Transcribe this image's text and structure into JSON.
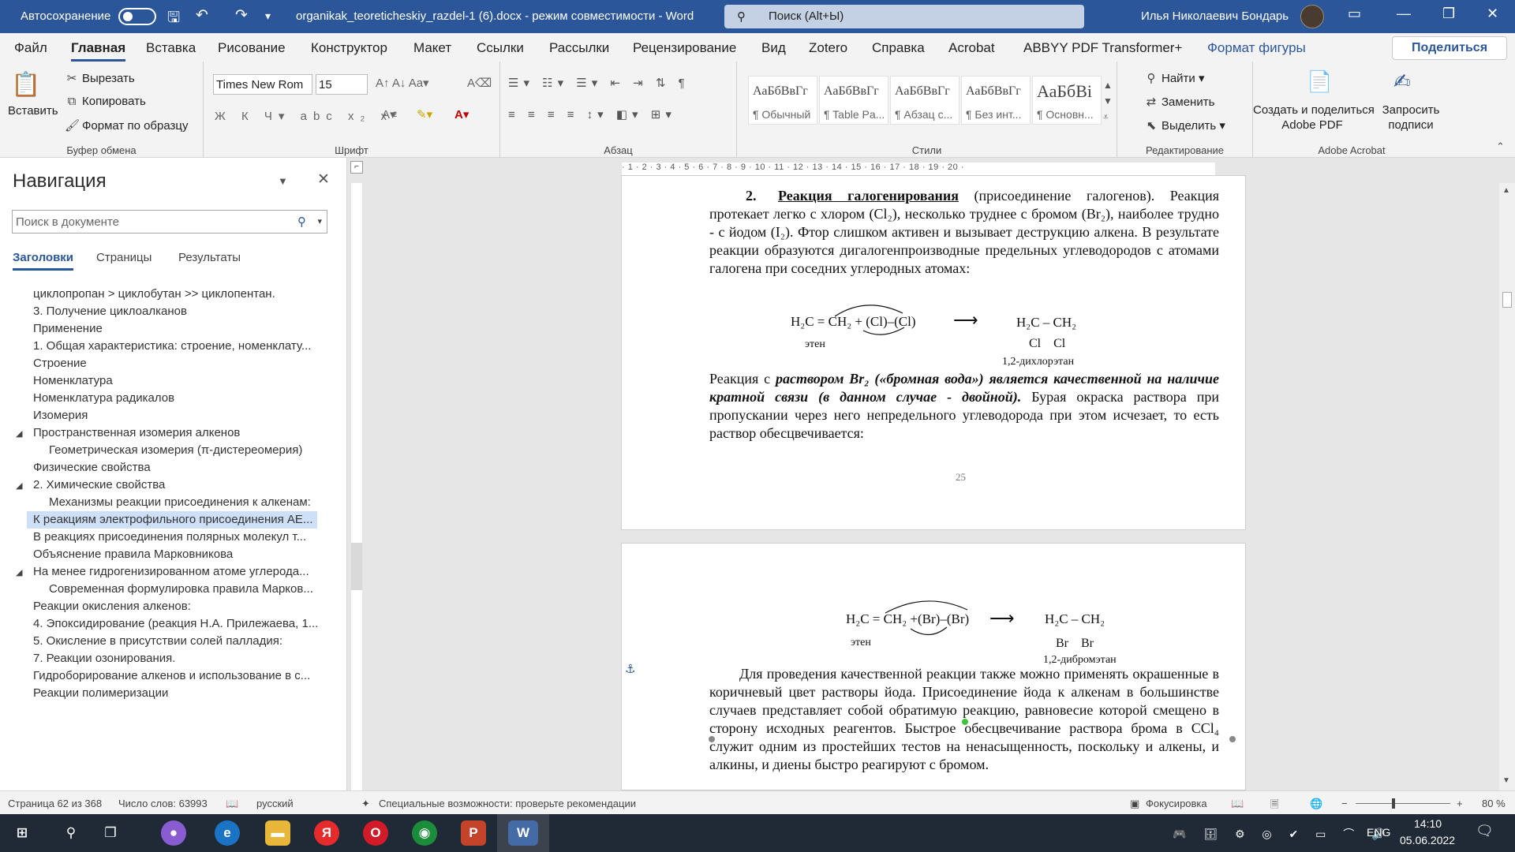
{
  "titlebar": {
    "autosave_label": "Автосохранение",
    "doc_title": "organikak_teoreticheskiy_razdel-1 (6).docx  -  режим совместимости  -  Word",
    "search_placeholder": "Поиск (Alt+Ы)",
    "user_name": "Илья Николаевич Бондарь"
  },
  "tabs": [
    "Файл",
    "Главная",
    "Вставка",
    "Рисование",
    "Конструктор",
    "Макет",
    "Ссылки",
    "Рассылки",
    "Рецензирование",
    "Вид",
    "Zotero",
    "Справка",
    "Acrobat",
    "ABBYY PDF Transformer+",
    "Формат фигуры"
  ],
  "share_label": "Поделиться",
  "ribbon": {
    "clipboard": {
      "paste": "Вставить",
      "cut": "Вырезать",
      "copy": "Копировать",
      "format_painter": "Формат по образцу",
      "label": "Буфер обмена"
    },
    "font": {
      "family": "Times New Rom",
      "size": "15",
      "label": "Шрифт"
    },
    "paragraph": {
      "label": "Абзац"
    },
    "styles": {
      "label": "Стили",
      "items": [
        {
          "sample": "АаБбВвГг",
          "name": "¶ Обычный"
        },
        {
          "sample": "АаБбВвГг",
          "name": "¶ Table Pa..."
        },
        {
          "sample": "АаБбВвГг",
          "name": "¶ Абзац с..."
        },
        {
          "sample": "АаБбВвГг",
          "name": "¶ Без инт..."
        },
        {
          "sample": "АаБбВі",
          "name": "¶ Основн..."
        }
      ]
    },
    "editing": {
      "find": "Найти",
      "replace": "Заменить",
      "select": "Выделить",
      "label": "Редактирование"
    },
    "acrobat": {
      "create": "Создать и поделиться",
      "create2": "Adobe PDF",
      "request": "Запросить",
      "request2": "подписи",
      "label": "Adobe Acrobat"
    }
  },
  "nav": {
    "title": "Навигация",
    "search_placeholder": "Поиск в документе",
    "tabs": [
      "Заголовки",
      "Страницы",
      "Результаты"
    ],
    "headings": [
      {
        "text": "циклопропан > циклобутан >> циклопентан.",
        "level": 1
      },
      {
        "text": "3. Получение циклоалканов",
        "level": 1
      },
      {
        "text": "Применение",
        "level": 1
      },
      {
        "text": "1.  Общая характеристика: строение, номенклату...",
        "level": 1
      },
      {
        "text": "Строение",
        "level": 1
      },
      {
        "text": "Номенклатура",
        "level": 1
      },
      {
        "text": "Номенклатура радикалов",
        "level": 1
      },
      {
        "text": "Изомерия",
        "level": 1
      },
      {
        "text": "Пространственная изомерия алкенов",
        "level": 1,
        "expanded": true
      },
      {
        "text": "Геометрическая изомерия (π-дистереомерия)",
        "level": 2
      },
      {
        "text": "Физические свойства",
        "level": 1
      },
      {
        "text": "2.   Химические свойства",
        "level": 1,
        "expanded": true
      },
      {
        "text": "Механизмы реакции присоединения к алкенам:",
        "level": 2
      },
      {
        "text": "К реакциям электрофильного присоединения AE...",
        "level": 1,
        "selected": true
      },
      {
        "text": "В реакциях присоединения полярных молекул т...",
        "level": 1
      },
      {
        "text": "Объяснение правила Марковникова",
        "level": 1
      },
      {
        "text": "На менее гидрогенизированном атоме углерода...",
        "level": 1,
        "expanded": true
      },
      {
        "text": "Современная формулировка правила Марков...",
        "level": 2
      },
      {
        "text": "Реакции окисления алкенов:",
        "level": 1
      },
      {
        "text": "4. Эпоксидирование (реакция Н.А. Прилежаева, 1...",
        "level": 1
      },
      {
        "text": "5. Окисление в присутствии солей палладия:",
        "level": 1
      },
      {
        "text": "7. Реакции озонирования.",
        "level": 1
      },
      {
        "text": "Гидроборирование алкенов и использование в с...",
        "level": 1
      },
      {
        "text": "Реакции полимеризации",
        "level": 1
      }
    ]
  },
  "page1": {
    "p1_num": "2.",
    "p1_title": "Реакция галогенирования",
    "p1_rest": " (присоединение галогенов). Реакция протекает легко с хлором (Cl₂), несколько труднее с бромом (Br₂), наиболее трудно - с йодом (I₂). Фтор слишком активен и вызывает деструкцию алкена. В результате реакции образуются дигалогенпроизводные предельных углеводородов с атомами галогена при соседних углеродных атомах:",
    "eq_left": "H₂C = CH₂ + (Cl)–(Cl)",
    "eq_left_label": "этен",
    "eq_right": "H₂C – CH₂",
    "eq_right_sub": "Cl    Cl",
    "eq_right_label": "1,2-дихлорэтан",
    "p2_a": "Реакция с ",
    "p2_b": "раствором Br₂ («бромная вода») является качественной на наличие кратной связи (в данном случае - двойной).",
    "p2_c": " Бурая окраска раствора при пропускании через него непредельного углеводорода при этом исчезает, то есть раствор обесцвечивается:",
    "page_number": "25"
  },
  "page2": {
    "eq_left": "H₂C = CH₂ +(Br)–(Br)",
    "eq_left_label": "этен",
    "eq_right": "H₂C – CH₂",
    "eq_right_sub": "Br    Br",
    "eq_right_label": "1,2-дибромэтан",
    "p1": "Для проведения качественной реакции также можно применять окрашенные в коричневый цвет растворы йода. Присоединение йода к алкенам в большинстве случаев представляет собой обратимую реакцию, равновесие которой смещено в сторону исходных реагентов. Быстрое обесцвечивание раствора брома в CCl₄ служит одним из простейших тестов на ненасыщенность, поскольку и алкены, и алкины, и диены быстро реагируют с бромом."
  },
  "ruler": "· 1 · 2 · 3 · 4 · 5 · 6 · 7 · 8 · 9 · 10 · 11 · 12 · 13 · 14 · 15 · 16 · 17 · 18 · 19 · 20 ·",
  "status": {
    "page": "Страница 62 из 368",
    "words": "Число слов: 63993",
    "lang": "русский",
    "accessibility": "Специальные возможности: проверьте рекомендации",
    "focus": "Фокусировка",
    "zoom": "80 %"
  },
  "taskbar": {
    "lang": "ENG",
    "time": "14:10",
    "date": "05.06.2022"
  }
}
